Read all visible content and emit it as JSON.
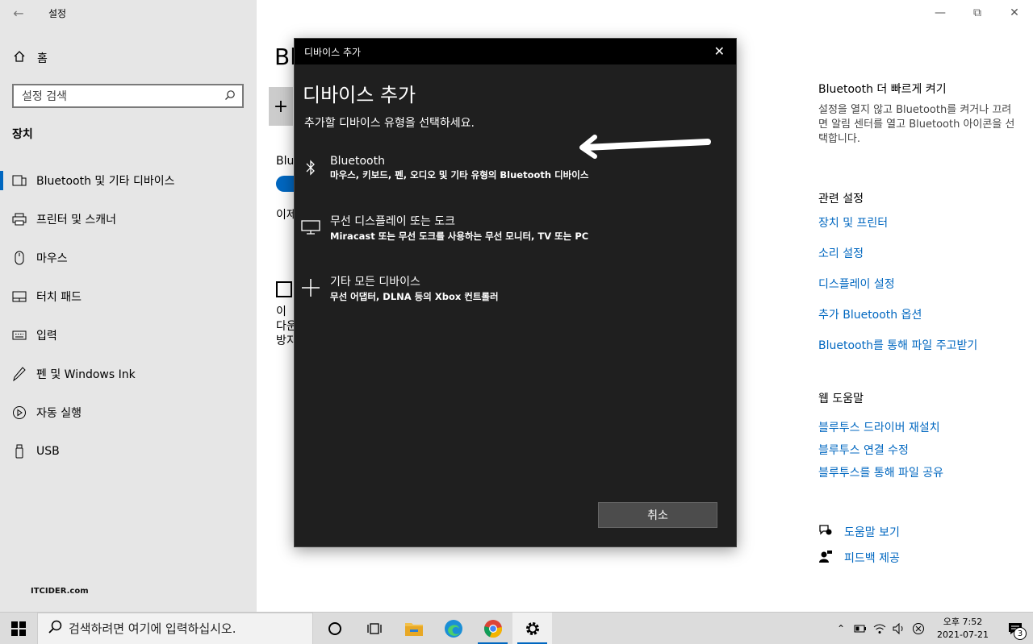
{
  "window": {
    "app_title": "설정",
    "minimize_icon": "minimize-icon",
    "maximize_icon": "restore-icon",
    "close_icon": "close-icon"
  },
  "sidebar": {
    "home_label": "홈",
    "search_placeholder": "설정 검색",
    "section_title": "장치",
    "items": [
      {
        "label": "Bluetooth 및 기타 디바이스",
        "icon": "bluetooth-devices-icon",
        "active": true
      },
      {
        "label": "프린터 및 스캐너",
        "icon": "printer-icon"
      },
      {
        "label": "마우스",
        "icon": "mouse-icon"
      },
      {
        "label": "터치 패드",
        "icon": "touchpad-icon"
      },
      {
        "label": "입력",
        "icon": "keyboard-icon"
      },
      {
        "label": "펜 및 Windows Ink",
        "icon": "pen-icon"
      },
      {
        "label": "자동 실행",
        "icon": "autoplay-icon"
      },
      {
        "label": "USB",
        "icon": "usb-icon"
      }
    ],
    "watermark": "ITCIDER.com"
  },
  "background": {
    "heading_partial": "Bl",
    "add_partial": "+",
    "bluetooth_label_partial": "Blue",
    "text1_partial": "이제",
    "text2_lines": [
      "이",
      "다운",
      "방지"
    ]
  },
  "right_panel": {
    "quick_title": "Bluetooth 더 빠르게 켜기",
    "quick_desc": "설정을 열지 않고 Bluetooth를 켜거나 끄려면 알림 센터를 열고 Bluetooth 아이콘을 선택합니다.",
    "related_title": "관련 설정",
    "related_links": [
      "장치 및 프린터",
      "소리 설정",
      "디스플레이 설정",
      "추가 Bluetooth 옵션",
      "Bluetooth를 통해 파일 주고받기"
    ],
    "help_title": "웹 도움말",
    "help_links": [
      "블루투스 드라이버 재설치",
      "블루투스 연결 수정",
      "블루투스를 통해 파일 공유"
    ],
    "get_help": "도움말 보기",
    "feedback": "피드백 제공"
  },
  "dialog": {
    "title_bar": "디바이스 추가",
    "heading": "디바이스 추가",
    "subtitle": "추가할 디바이스 유형을 선택하세요.",
    "options": [
      {
        "title": "Bluetooth",
        "desc": "마우스, 키보드, 펜, 오디오 및 기타 유형의 Bluetooth 디바이스",
        "icon": "bluetooth-icon"
      },
      {
        "title": "무선 디스플레이 또는 도크",
        "desc": "Miracast 또는 무선 도크를 사용하는 무선 모니터, TV 또는 PC",
        "icon": "monitor-icon"
      },
      {
        "title": "기타 모든 디바이스",
        "desc": "무선 어댑터, DLNA 등의 Xbox 컨트롤러",
        "icon": "plus-icon"
      }
    ],
    "cancel_label": "취소"
  },
  "taskbar": {
    "search_placeholder": "검색하려면 여기에 입력하십시오.",
    "time": "오후 7:52",
    "date": "2021-07-21",
    "notification_count": "3"
  }
}
